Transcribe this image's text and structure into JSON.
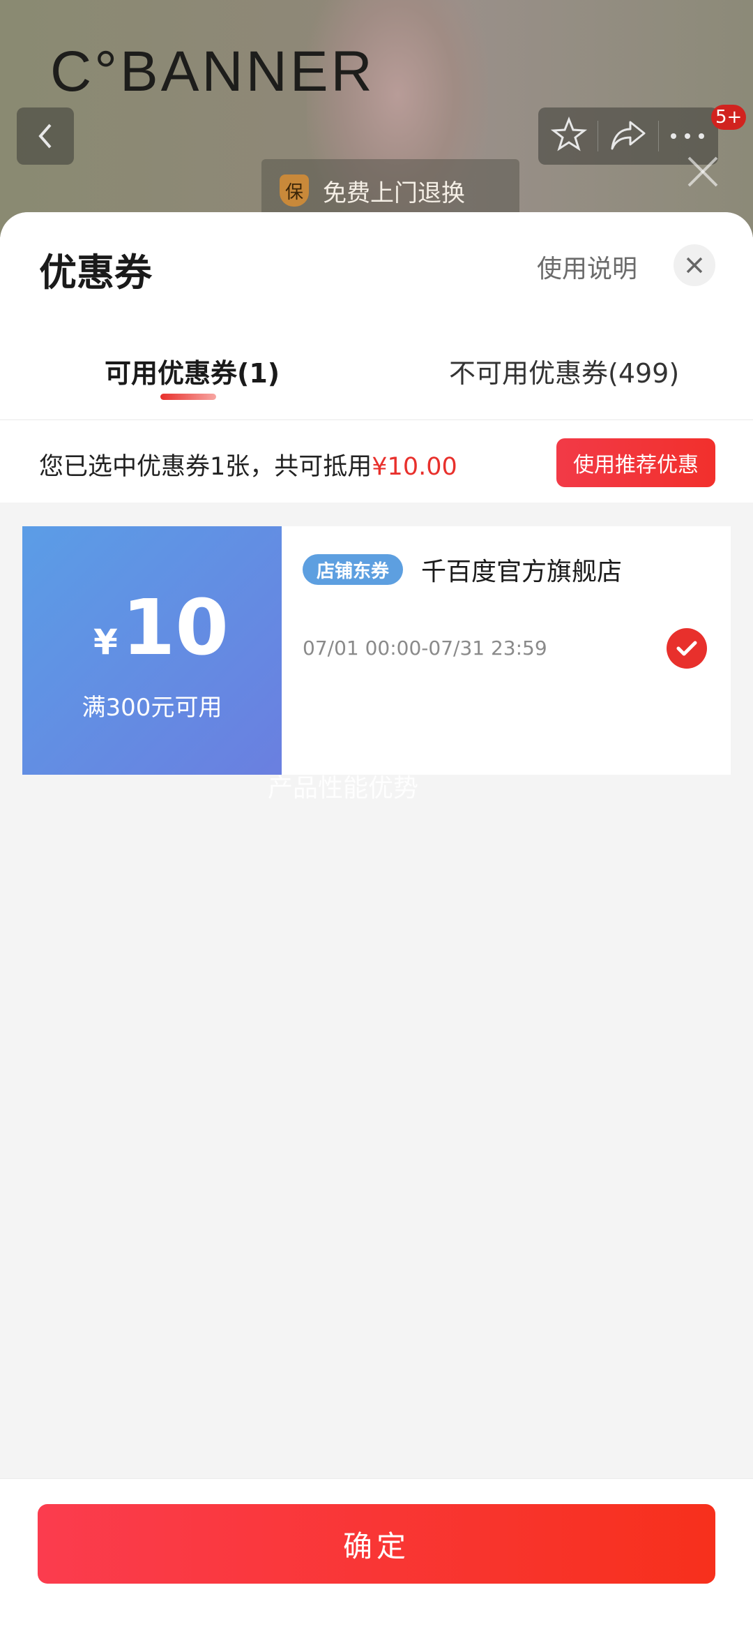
{
  "background": {
    "brand": "C°BANNER",
    "cart_badge": "5+",
    "guarantee": {
      "icon_char": "保",
      "text": "免费上门退换"
    }
  },
  "sheet": {
    "title": "优惠券",
    "usage_link": "使用说明",
    "tabs": [
      {
        "label": "可用优惠券(1)",
        "active": true
      },
      {
        "label": "不可用优惠券(499)",
        "active": false
      }
    ],
    "summary": {
      "text": "您已选中优惠券1张，共可抵用",
      "amount": "¥10.00"
    },
    "recommend_button": "使用推荐优惠",
    "coupon": {
      "currency": "¥",
      "value": "10",
      "condition": "满300元可用",
      "tag": "店铺东券",
      "store": "千百度官方旗舰店",
      "validity": "07/01 00:00-07/31 23:59",
      "selected": true
    },
    "watermark": "产品性能优势",
    "confirm_button": "确定"
  },
  "colors": {
    "accent_red": "#e8302c",
    "coupon_blue": "#5b9de6"
  }
}
